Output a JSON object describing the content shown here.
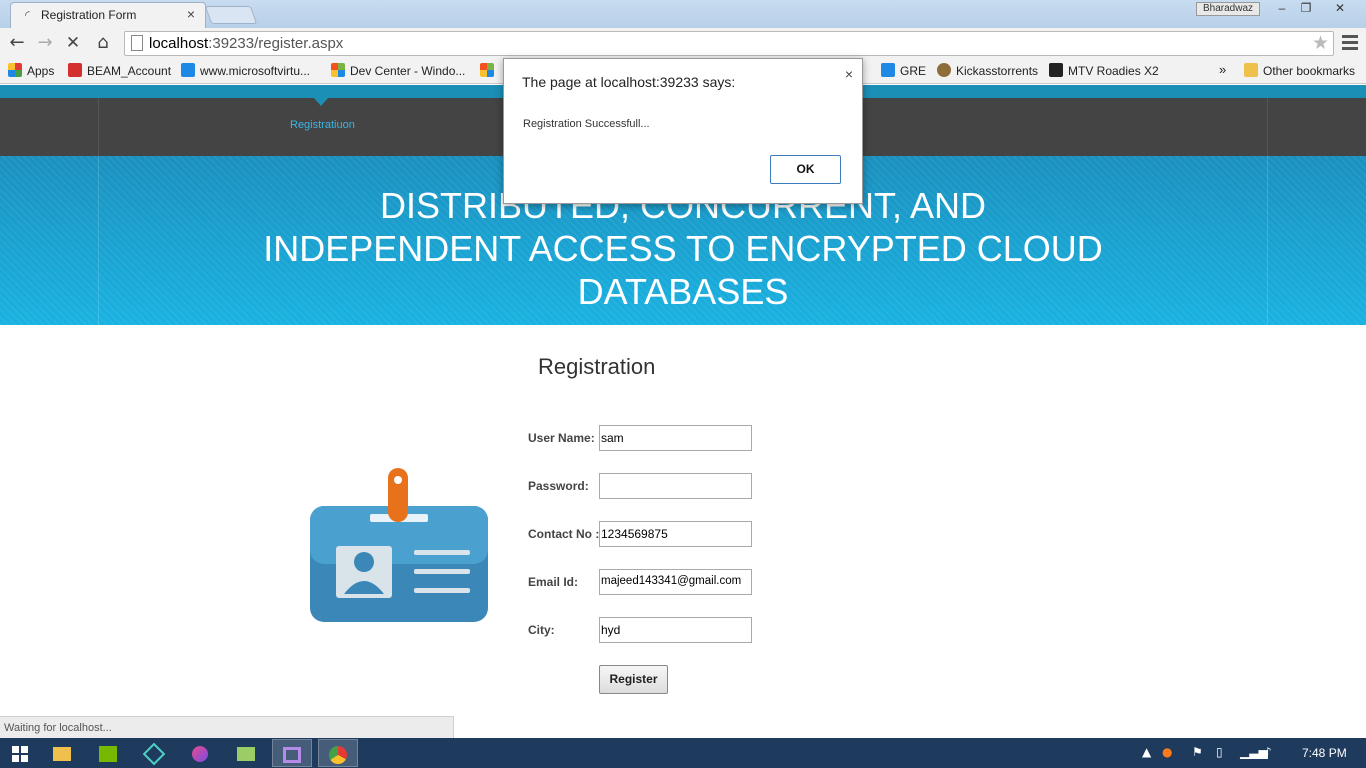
{
  "browser": {
    "tab_title": "Registration Form",
    "tab_close": "×",
    "user_badge": "Bharadwaz",
    "window_controls": {
      "minimize": "–",
      "restore": "❐",
      "close": "✕"
    },
    "url_host": "localhost",
    "url_rest": ":39233/register.aspx",
    "status_text": "Waiting for localhost..."
  },
  "bookmarks": [
    {
      "label": "Apps",
      "icon": "apps-grid-icon",
      "color": "#e53935"
    },
    {
      "label": "BEAM_Account",
      "icon": "act-logo-icon",
      "color": "#d32f2f"
    },
    {
      "label": "www.microsoftvirtu...",
      "icon": "mva-icon",
      "color": "#1e88e5"
    },
    {
      "label": "Dev Center - Windo...",
      "icon": "windows-icon",
      "color": "#f4511e"
    },
    {
      "label": "GRE",
      "icon": "google-g-icon",
      "color": "#1e88e5"
    },
    {
      "label": "Kickasstorrents",
      "icon": "kickass-icon",
      "color": "#8d6e3b"
    },
    {
      "label": "MTV Roadies X2",
      "icon": "mtv-icon",
      "color": "#222222"
    }
  ],
  "bookmarks_overflow": "»",
  "other_bookmarks": "Other bookmarks",
  "site": {
    "nav_link": "Registratiuon",
    "title_line1": "DISTRIBUTED, CONCURRENT, AND",
    "title_line2": "INDEPENDENT ACCESS TO ENCRYPTED CLOUD",
    "title_line3": "DATABASES",
    "colors": {
      "accent": "#1b8fb6",
      "nav_bg": "#444444",
      "banner_top": "#1a90bf",
      "banner_bottom": "#19b2e1"
    }
  },
  "form": {
    "title": "Registration",
    "fields": {
      "username": {
        "label": "User Name:",
        "value": "sam"
      },
      "password": {
        "label": "Password:",
        "value": ""
      },
      "contact": {
        "label": "Contact No :",
        "value": "1234569875"
      },
      "email": {
        "label": "Email Id:",
        "value": "majeed143341@gmail.com"
      },
      "city": {
        "label": "City:",
        "value": "hyd"
      }
    },
    "submit_label": "Register"
  },
  "dialog": {
    "title": "The page at localhost:39233 says:",
    "message": "Registration Successfull...",
    "ok_label": "OK",
    "close": "×"
  },
  "taskbar": {
    "clock": "7:48 PM"
  }
}
